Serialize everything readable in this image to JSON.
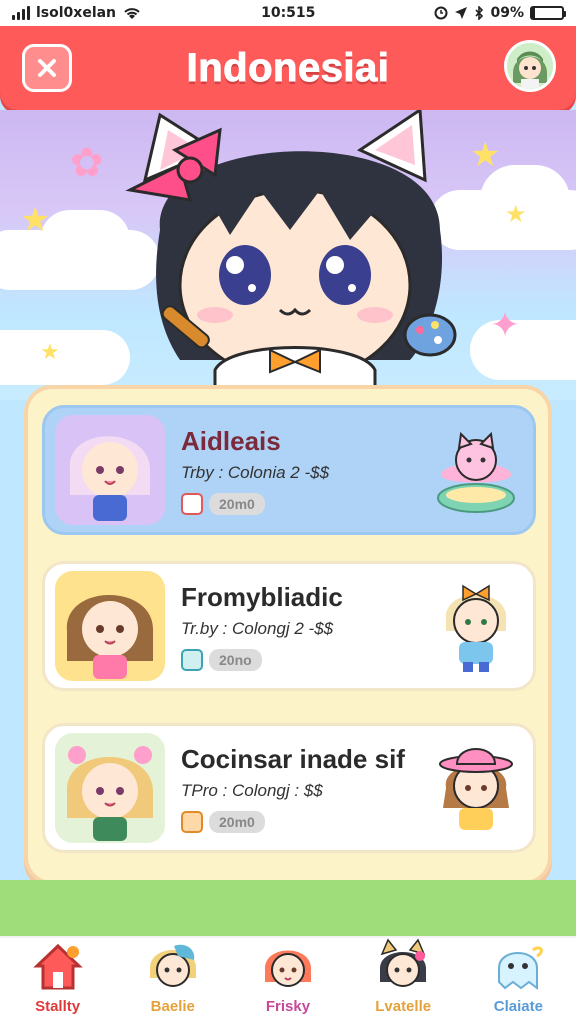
{
  "status_bar": {
    "carrier": "lsol0xelan",
    "time": "10:515",
    "battery": "09%",
    "icons": [
      "signal-icon",
      "wifi-icon",
      "alarm-icon",
      "location-icon",
      "bluetooth-icon",
      "battery-icon"
    ]
  },
  "header": {
    "title": "Indonesiai",
    "close_icon": "close-icon",
    "avatar_icon": "avatar-icon"
  },
  "colors": {
    "accent": "#ff5a5a",
    "panel": "#fdf3c9",
    "selected_card": "#aed3f6"
  },
  "items": [
    {
      "title": "Aidleais",
      "subtitle": "Trby : Colonia 2 -$$",
      "badge": "20m0",
      "thumbnail": "character-lilac-hair-icon",
      "sticker": "pink-cat-float-icon",
      "selected": true
    },
    {
      "title": "Fromybliadic",
      "subtitle": "Tr.by : Colongj 2 -$$",
      "badge": "20no",
      "thumbnail": "character-brown-hair-icon",
      "sticker": "blonde-boy-bow-icon",
      "selected": false
    },
    {
      "title": "Cocinsar inade sif",
      "subtitle": "TPro : Colongj : $$",
      "badge": "20m0",
      "thumbnail": "character-blonde-flowers-icon",
      "sticker": "girl-pink-hat-icon",
      "selected": false
    }
  ],
  "bottom_nav": [
    {
      "label": "Stallty",
      "icon": "home-icon",
      "color": "#e03b3b"
    },
    {
      "label": "Baelie",
      "icon": "blonde-boy-icon",
      "color": "#e5a13a"
    },
    {
      "label": "Frisky",
      "icon": "redhead-girl-icon",
      "color": "#c64a9a"
    },
    {
      "label": "Lvatelle",
      "icon": "cat-girl-icon",
      "color": "#e5a13a"
    },
    {
      "label": "Claiate",
      "icon": "ghost-icon",
      "color": "#5a9bd6"
    }
  ]
}
